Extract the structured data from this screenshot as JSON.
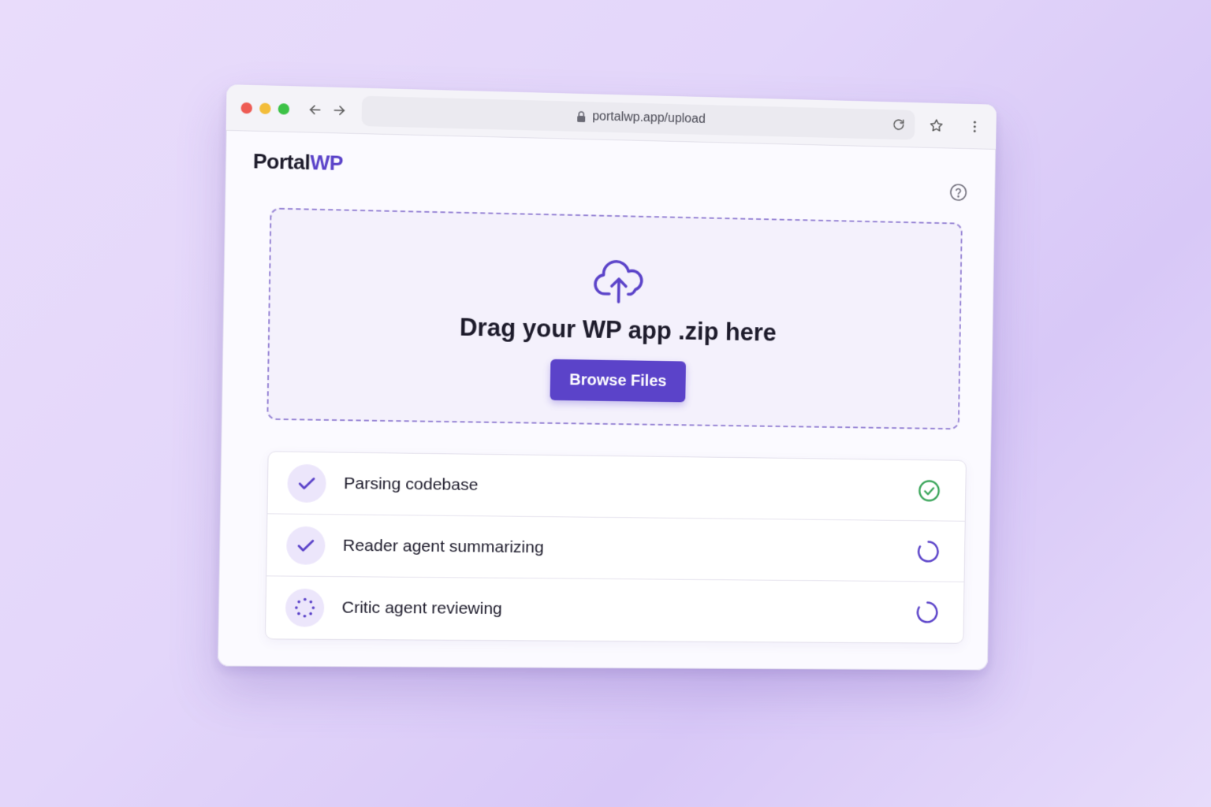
{
  "browser": {
    "url": "portalwp.app/upload"
  },
  "app": {
    "logo_main": "Portal",
    "logo_accent": "WP"
  },
  "dropzone": {
    "title": "Drag your WP app .zip here",
    "browse_label": "Browse Files"
  },
  "steps": [
    {
      "label": "Parsing codebase",
      "state": "complete"
    },
    {
      "label": "Reader agent summarizing",
      "state": "in-progress"
    },
    {
      "label": "Critic agent reviewing",
      "state": "in-progress"
    }
  ],
  "colors": {
    "accent": "#5b43c9",
    "success": "#3aa55a",
    "background": "#e3d6fa"
  },
  "icons": {
    "upload": "cloud-upload-icon",
    "help": "help-circle-icon",
    "complete": "check-circle-icon",
    "loading": "spinner-icon"
  }
}
